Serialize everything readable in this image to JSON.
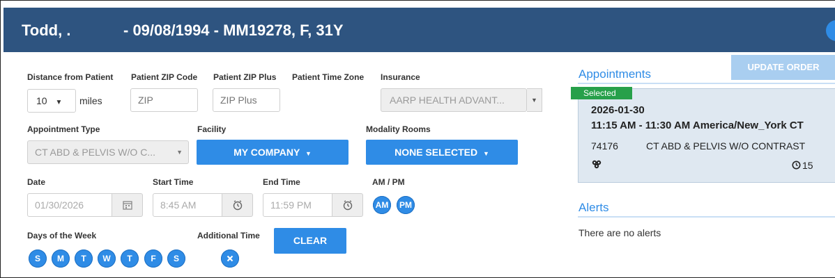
{
  "header": {
    "patient_name": "Todd, .",
    "patient_info": "- 09/08/1994 - MM19278, F, 31Y"
  },
  "search": {
    "distance_label": "Distance from Patient",
    "distance_value": "10",
    "distance_unit": "miles",
    "zip_label": "Patient ZIP Code",
    "zip_placeholder": "ZIP",
    "zip_plus_label": "Patient ZIP Plus",
    "zip_plus_placeholder": "ZIP Plus",
    "time_zone_label": "Patient Time Zone",
    "insurance_label": "Insurance",
    "insurance_value": "AARP HEALTH ADVANT..."
  },
  "appointment_type": {
    "label": "Appointment Type",
    "value": "CT ABD & PELVIS W/O C..."
  },
  "facility": {
    "label": "Facility",
    "button": "MY COMPANY"
  },
  "modality": {
    "label": "Modality Rooms",
    "button": "NONE SELECTED"
  },
  "date": {
    "label": "Date",
    "value": "01/30/2026"
  },
  "start_time": {
    "label": "Start Time",
    "value": "8:45 AM"
  },
  "end_time": {
    "label": "End Time",
    "value": "11:59 PM"
  },
  "ampm": {
    "label": "AM / PM",
    "am": "AM",
    "pm": "PM"
  },
  "days": {
    "label": "Days of the Week",
    "items": [
      "S",
      "M",
      "T",
      "W",
      "T",
      "F",
      "S"
    ]
  },
  "additional_time": {
    "label": "Additional Time"
  },
  "clear_button": "CLEAR",
  "update_order_button": "UPDATE ORDER",
  "appointments": {
    "title": "Appointments",
    "card": {
      "badge": "Selected",
      "date": "2026-01-30",
      "time": "11:15 AM - 11:30 AM America/New_York CT",
      "code": "74176",
      "description": "CT ABD & PELVIS W/O CONTRAST",
      "duration": "15"
    }
  },
  "alerts": {
    "title": "Alerts",
    "empty_text": "There are no alerts"
  },
  "colors": {
    "header_bg": "#2e5480",
    "accent_blue": "#2f8ce6",
    "selected_green": "#27a04a",
    "card_bg": "#dfe8f1"
  },
  "icons": {
    "calendar": "calendar-icon",
    "clock": "clock-icon",
    "remove": "remove-icon",
    "group": "group-icon",
    "duration": "clock-icon"
  }
}
